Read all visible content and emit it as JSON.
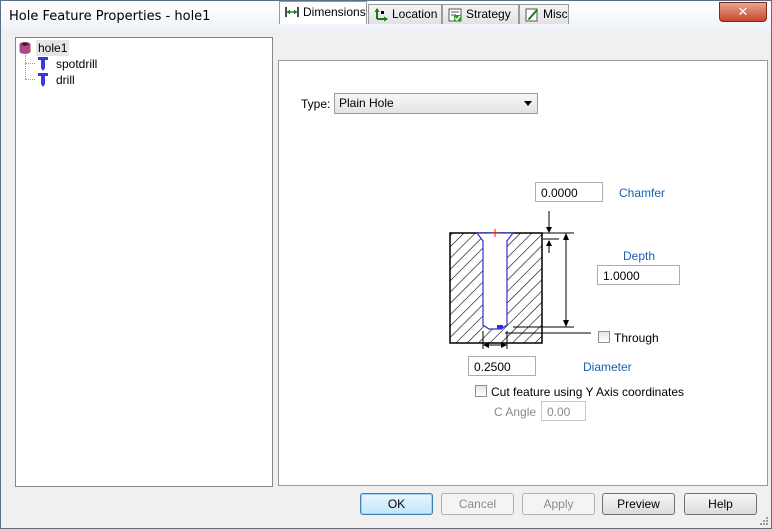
{
  "window": {
    "title": "Hole Feature Properties - hole1",
    "close_label": "✕"
  },
  "tree": {
    "items": [
      {
        "label": "hole1",
        "icon": "hole-feature-icon",
        "selected": true
      },
      {
        "label": "spotdrill",
        "icon": "spotdrill-tool-icon",
        "selected": false
      },
      {
        "label": "drill",
        "icon": "drill-tool-icon",
        "selected": false
      }
    ]
  },
  "tabs": [
    {
      "label": "Dimensions",
      "icon": "dimensions-icon",
      "active": true
    },
    {
      "label": "Location",
      "icon": "location-axes-icon",
      "active": false
    },
    {
      "label": "Strategy",
      "icon": "strategy-icon",
      "active": false
    },
    {
      "label": "Misc",
      "icon": "misc-edit-icon",
      "active": false
    }
  ],
  "dimensions": {
    "type_label": "Type:",
    "type_value": "Plain Hole",
    "chamfer_label": "Chamfer",
    "chamfer_value": "0.0000",
    "depth_label": "Depth",
    "depth_value": "1.0000",
    "through_label": "Through",
    "through_checked": false,
    "diameter_label": "Diameter",
    "diameter_value": "0.2500",
    "cut_y_axis_label": "Cut feature using Y Axis coordinates",
    "cut_y_axis_checked": false,
    "c_angle_label": "C Angle",
    "c_angle_value": "0.00"
  },
  "buttons": {
    "ok": "OK",
    "cancel": "Cancel",
    "apply": "Apply",
    "preview": "Preview",
    "help": "Help"
  },
  "colors": {
    "accent_blue": "#1a5fb4",
    "close_red": "#c8462e",
    "hole_outline": "#2f2fd6"
  }
}
